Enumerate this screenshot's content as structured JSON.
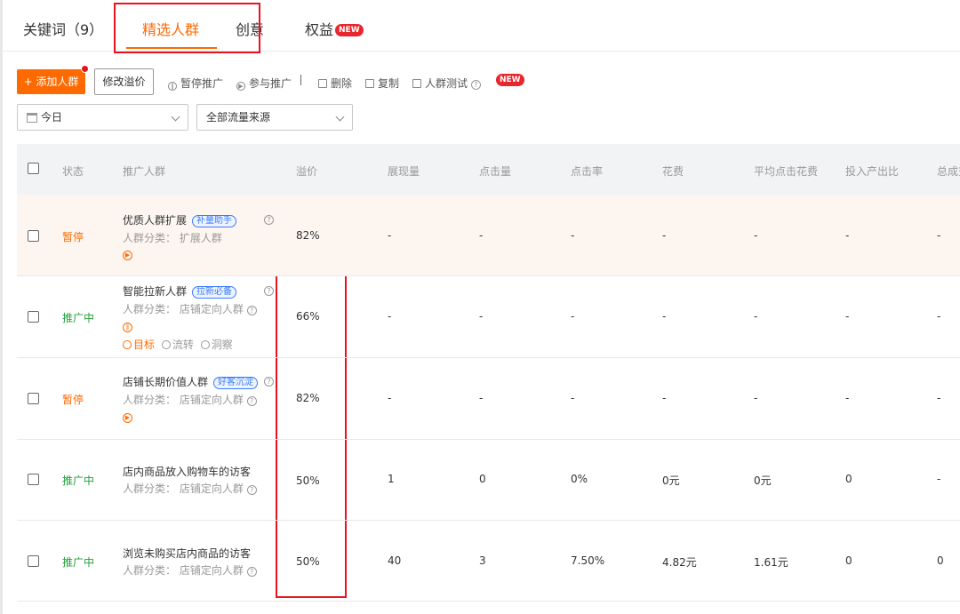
{
  "tabs": [
    {
      "label": "关键词（9）"
    },
    {
      "label": "精选人群"
    },
    {
      "label": "创意"
    },
    {
      "label": "权益",
      "badge": "NEW"
    }
  ],
  "toolbar": {
    "add_crowd": "+ 添加人群",
    "modify_premium": "修改溢价",
    "pause": "暂停推广",
    "join": "参与推广",
    "delete": "删除",
    "copy": "复制",
    "crowd_test": "人群测试",
    "new_badge": "NEW"
  },
  "filters": {
    "date": "今日",
    "traffic_source": "全部流量来源"
  },
  "columns": [
    "状态",
    "推广人群",
    "溢价",
    "展现量",
    "点击量",
    "点击率",
    "花费",
    "平均点击花费",
    "投入产出比",
    "总成交"
  ],
  "rows": [
    {
      "status": "暂停",
      "name": "优质人群扩展",
      "tag": "补量助手",
      "category": "人群分类： 扩展人群",
      "premium": "82%",
      "impressions": "-",
      "clicks": "-",
      "ctr": "-",
      "cost": "-",
      "cpc": "-",
      "roi": "-",
      "total": "-"
    },
    {
      "status": "推广中",
      "name": "智能拉新人群",
      "tag": "拉新必备",
      "category": "人群分类： 店铺定向人群",
      "premium": "66%",
      "impressions": "-",
      "clicks": "-",
      "ctr": "-",
      "cost": "-",
      "cpc": "-",
      "roi": "-",
      "total": "-",
      "actions": {
        "goal": "目标",
        "flow": "流转",
        "insight": "洞察"
      }
    },
    {
      "status": "暂停",
      "name": "店铺长期价值人群",
      "tag": "好客沉淀",
      "category": "人群分类： 店铺定向人群",
      "premium": "82%",
      "impressions": "-",
      "clicks": "-",
      "ctr": "-",
      "cost": "-",
      "cpc": "-",
      "roi": "-",
      "total": "-"
    },
    {
      "status": "推广中",
      "name": "店内商品放入购物车的访客",
      "category": "人群分类： 店铺定向人群",
      "premium": "50%",
      "impressions": "1",
      "clicks": "0",
      "ctr": "0%",
      "cost": "0元",
      "cpc": "0元",
      "roi": "0",
      "total": "-"
    },
    {
      "status": "推广中",
      "name": "浏览未购买店内商品的访客",
      "category": "人群分类： 店铺定向人群",
      "premium": "50%",
      "impressions": "40",
      "clicks": "3",
      "ctr": "7.50%",
      "cost": "4.82元",
      "cpc": "1.61元",
      "roi": "0",
      "total": "0"
    }
  ],
  "colors": {
    "accent": "#ff6a00",
    "active": "#21a038",
    "highlight_box": "#e6141e",
    "tag_blue": "#3b7bff"
  }
}
